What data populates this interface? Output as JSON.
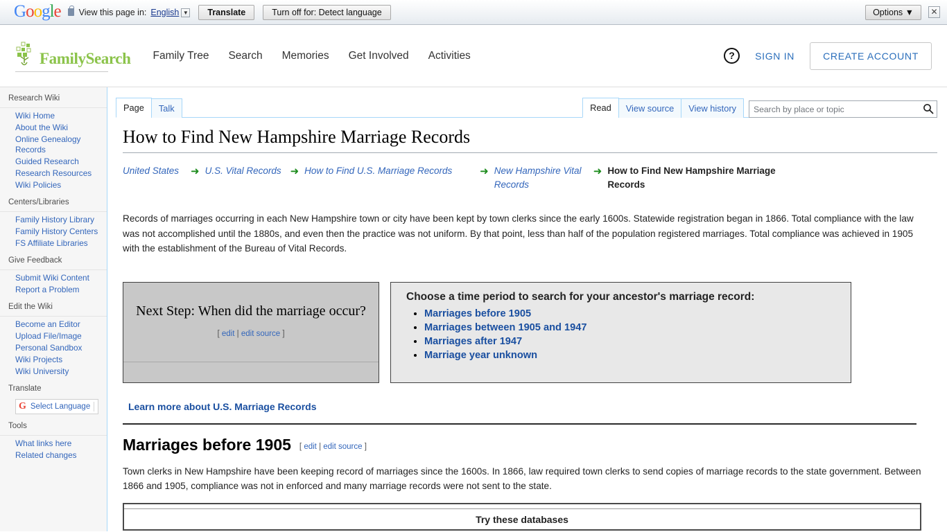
{
  "translate_bar": {
    "logo": "Google",
    "lock_icon": "lock-icon",
    "prompt": "View this page in:",
    "language": "English",
    "translate_label": "Translate",
    "turn_off_label": "Turn off for: Detect language",
    "options_label": "Options ▼",
    "close_label": "✕"
  },
  "header": {
    "brand": "FamilySearch",
    "nav": [
      {
        "label": "Family Tree"
      },
      {
        "label": "Search"
      },
      {
        "label": "Memories"
      },
      {
        "label": "Get Involved"
      },
      {
        "label": "Activities"
      }
    ],
    "help_label": "?",
    "sign_in": "SIGN IN",
    "create_account": "CREATE ACCOUNT"
  },
  "sidebar": {
    "portlets": [
      {
        "heading": "Research Wiki",
        "items": [
          {
            "label": "Wiki Home"
          },
          {
            "label": "About the Wiki"
          },
          {
            "label": "Online Genealogy Records"
          },
          {
            "label": "Guided Research"
          },
          {
            "label": "Research Resources"
          },
          {
            "label": "Wiki Policies"
          }
        ]
      },
      {
        "heading": "Centers/Libraries",
        "items": [
          {
            "label": "Family History Library"
          },
          {
            "label": "Family History Centers"
          },
          {
            "label": "FS Affiliate Libraries"
          }
        ]
      },
      {
        "heading": "Give Feedback",
        "items": [
          {
            "label": "Submit Wiki Content"
          },
          {
            "label": "Report a Problem"
          }
        ]
      },
      {
        "heading": "Edit the Wiki",
        "items": [
          {
            "label": "Become an Editor"
          },
          {
            "label": "Upload File/Image"
          },
          {
            "label": "Personal Sandbox"
          },
          {
            "label": "Wiki Projects"
          },
          {
            "label": "Wiki University"
          }
        ]
      }
    ],
    "translate_heading": "Translate",
    "select_language": "Select Language",
    "select_language_icon": "google-g-icon",
    "tools_heading": "Tools",
    "tools_items": [
      {
        "label": "What links here"
      },
      {
        "label": "Related changes"
      }
    ]
  },
  "tabs": {
    "namespace": [
      {
        "label": "Page",
        "selected": true
      },
      {
        "label": "Talk",
        "selected": false
      }
    ],
    "views": [
      {
        "label": "Read",
        "selected": true
      },
      {
        "label": "View source",
        "selected": false
      },
      {
        "label": "View history",
        "selected": false
      }
    ]
  },
  "search": {
    "placeholder": "Search by place or topic",
    "value": "",
    "icon": "search-icon"
  },
  "main": {
    "title": "How to Find New Hampshire Marriage Records",
    "breadcrumb": [
      {
        "label": "United States",
        "current": false
      },
      {
        "label": "U.S. Vital Records",
        "current": false
      },
      {
        "label": "How to Find U.S. Marriage Records",
        "current": false
      },
      {
        "label": "New Hampshire Vital Records",
        "current": false
      },
      {
        "label": "How to Find New Hampshire Marriage Records",
        "current": true
      }
    ],
    "intro_paragraph": "Records of marriages occurring in each New Hampshire town or city have been kept by town clerks since the early 1600s. Statewide registration began in 1866. Total compliance with the law was not accomplished until the 1880s, and even then the practice was not uniform. By that point, less than half of the population registered marriages. Total compliance was achieved in 1905 with the establishment of the Bureau of Vital Records.",
    "next_step": {
      "heading": "Next Step: When did the marriage occur?",
      "edit_open": "[",
      "edit_label": "edit",
      "edit_sep": "|",
      "edit_source_label": "edit source",
      "edit_close": "]"
    },
    "choose": {
      "title": "Choose a time period to search for your ancestor's marriage record:",
      "options": [
        {
          "label": "Marriages before 1905"
        },
        {
          "label": "Marriages between 1905 and 1947"
        },
        {
          "label": "Marriages after 1947"
        },
        {
          "label": "Marriage year unknown"
        }
      ]
    },
    "learn_more": "Learn more about U.S. Marriage Records",
    "section": {
      "heading": "Marriages before 1905",
      "edit_open": "[",
      "edit_label": "edit",
      "edit_sep": "|",
      "edit_source_label": "edit source",
      "edit_close": "]",
      "paragraph": "Town clerks in New Hampshire have been keeping record of marriages since the 1600s. In 1866, law required town clerks to send copies of marriage records to the state government. Between 1866 and 1905, compliance was not in enforced and many marriage records were not sent to the state."
    },
    "databases_box_title": "Try these databases"
  },
  "colors": {
    "brand_green": "#8bc34a",
    "link_blue": "#3366bb",
    "strong_link_blue": "#1a4fa0",
    "fs_blue": "#2a6ebb",
    "arrow_green": "#1e8c1e",
    "box_gray": "#c8c8c8",
    "panel_gray": "#e8e8e8"
  }
}
